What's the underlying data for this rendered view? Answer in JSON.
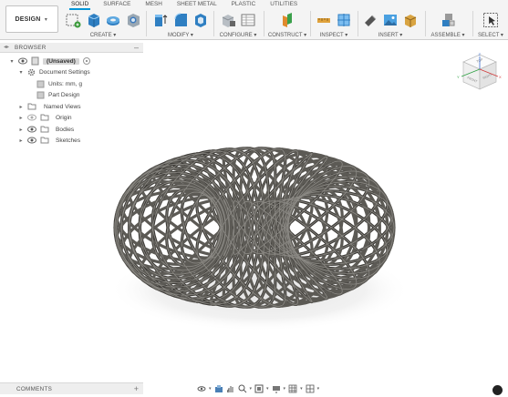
{
  "workspace": {
    "label": "DESIGN"
  },
  "tabs": [
    {
      "label": "SOLID",
      "active": true
    },
    {
      "label": "SURFACE",
      "active": false
    },
    {
      "label": "MESH",
      "active": false
    },
    {
      "label": "SHEET METAL",
      "active": false
    },
    {
      "label": "PLASTIC",
      "active": false
    },
    {
      "label": "UTILITIES",
      "active": false
    }
  ],
  "tool_groups": {
    "create": "CREATE",
    "modify": "MODIFY",
    "configure": "CONFIGURE",
    "construct": "CONSTRUCT",
    "inspect": "INSPECT",
    "insert": "INSERT",
    "assemble": "ASSEMBLE",
    "select": "SELECT"
  },
  "browser": {
    "title": "BROWSER",
    "root": "(Unsaved)",
    "document_settings": "Document Settings",
    "units": "Units: mm, g",
    "part_design": "Part Design",
    "named_views": "Named Views",
    "origin": "Origin",
    "bodies": "Bodies",
    "sketches": "Sketches"
  },
  "viewcube": {
    "top": "TOP",
    "front": "FRONT",
    "right": "RIGHT",
    "axis_x": "X",
    "axis_y": "Y",
    "axis_z": "Z"
  },
  "comments": {
    "title": "COMMENTS"
  },
  "colors": {
    "accent": "#0696d7",
    "model": "#5c5a55",
    "toolbar_bg": "#f4f4f4",
    "panel_bg": "#eeeeee"
  },
  "icons": [
    "chevron-down-icon",
    "eye-icon",
    "folder-icon",
    "gear-icon",
    "document-icon",
    "orbit-icon",
    "pan-icon",
    "zoom-icon",
    "display-icon",
    "grid-icon"
  ]
}
